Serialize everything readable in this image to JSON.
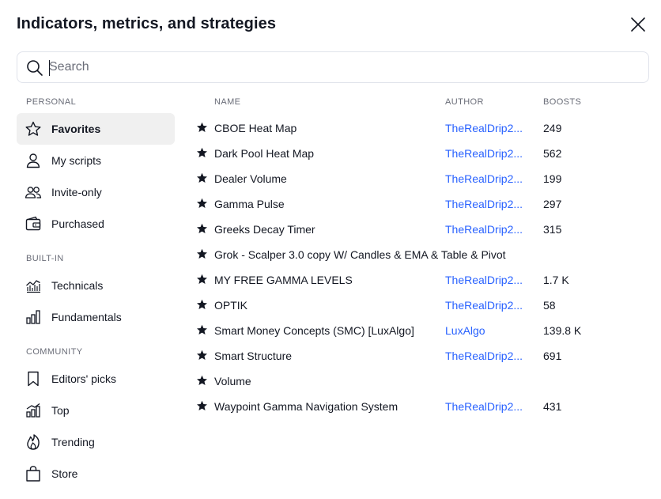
{
  "dialog": {
    "title": "Indicators, metrics, and strategies"
  },
  "search": {
    "placeholder": "Search",
    "value": ""
  },
  "sidebar": {
    "personal_label": "PERSONAL",
    "builtin_label": "BUILT-IN",
    "community_label": "COMMUNITY",
    "personal": [
      {
        "label": "Favorites",
        "icon": "star-outline-icon",
        "active": true
      },
      {
        "label": "My scripts",
        "icon": "user-icon"
      },
      {
        "label": "Invite-only",
        "icon": "users-icon"
      },
      {
        "label": "Purchased",
        "icon": "wallet-icon"
      }
    ],
    "builtin": [
      {
        "label": "Technicals",
        "icon": "technicals-chart-icon"
      },
      {
        "label": "Fundamentals",
        "icon": "bar-chart-icon"
      }
    ],
    "community": [
      {
        "label": "Editors' picks",
        "icon": "bookmark-icon"
      },
      {
        "label": "Top",
        "icon": "top-chart-icon"
      },
      {
        "label": "Trending",
        "icon": "flame-icon"
      },
      {
        "label": "Store",
        "icon": "shopping-bag-icon"
      }
    ]
  },
  "table": {
    "headers": {
      "name": "NAME",
      "author": "AUTHOR",
      "boosts": "BOOSTS"
    },
    "rows": [
      {
        "name": "CBOE Heat Map",
        "author": "TheRealDrip2...",
        "boosts": "249"
      },
      {
        "name": "Dark Pool Heat Map",
        "author": "TheRealDrip2...",
        "boosts": "562"
      },
      {
        "name": "Dealer Volume",
        "author": "TheRealDrip2...",
        "boosts": "199"
      },
      {
        "name": "Gamma Pulse",
        "author": "TheRealDrip2...",
        "boosts": "297"
      },
      {
        "name": "Greeks Decay Timer",
        "author": "TheRealDrip2...",
        "boosts": "315"
      },
      {
        "name": "Grok - Scalper 3.0 copy W/ Candles & EMA & Table & Pivot",
        "author": "",
        "boosts": ""
      },
      {
        "name": "MY FREE GAMMA LEVELS",
        "author": "TheRealDrip2...",
        "boosts": "1.7 K"
      },
      {
        "name": "OPTIK",
        "author": "TheRealDrip2...",
        "boosts": "58"
      },
      {
        "name": "Smart Money Concepts (SMC) [LuxAlgo]",
        "author": "LuxAlgo",
        "boosts": "139.8 K"
      },
      {
        "name": "Smart Structure",
        "author": "TheRealDrip2...",
        "boosts": "691"
      },
      {
        "name": "Volume",
        "author": "",
        "boosts": ""
      },
      {
        "name": "Waypoint Gamma Navigation System",
        "author": "TheRealDrip2...",
        "boosts": "431"
      }
    ]
  },
  "colors": {
    "accent_link": "#2962ff",
    "active_bg": "#f0f0f0",
    "text": "#131722",
    "muted": "#6a6d78"
  }
}
